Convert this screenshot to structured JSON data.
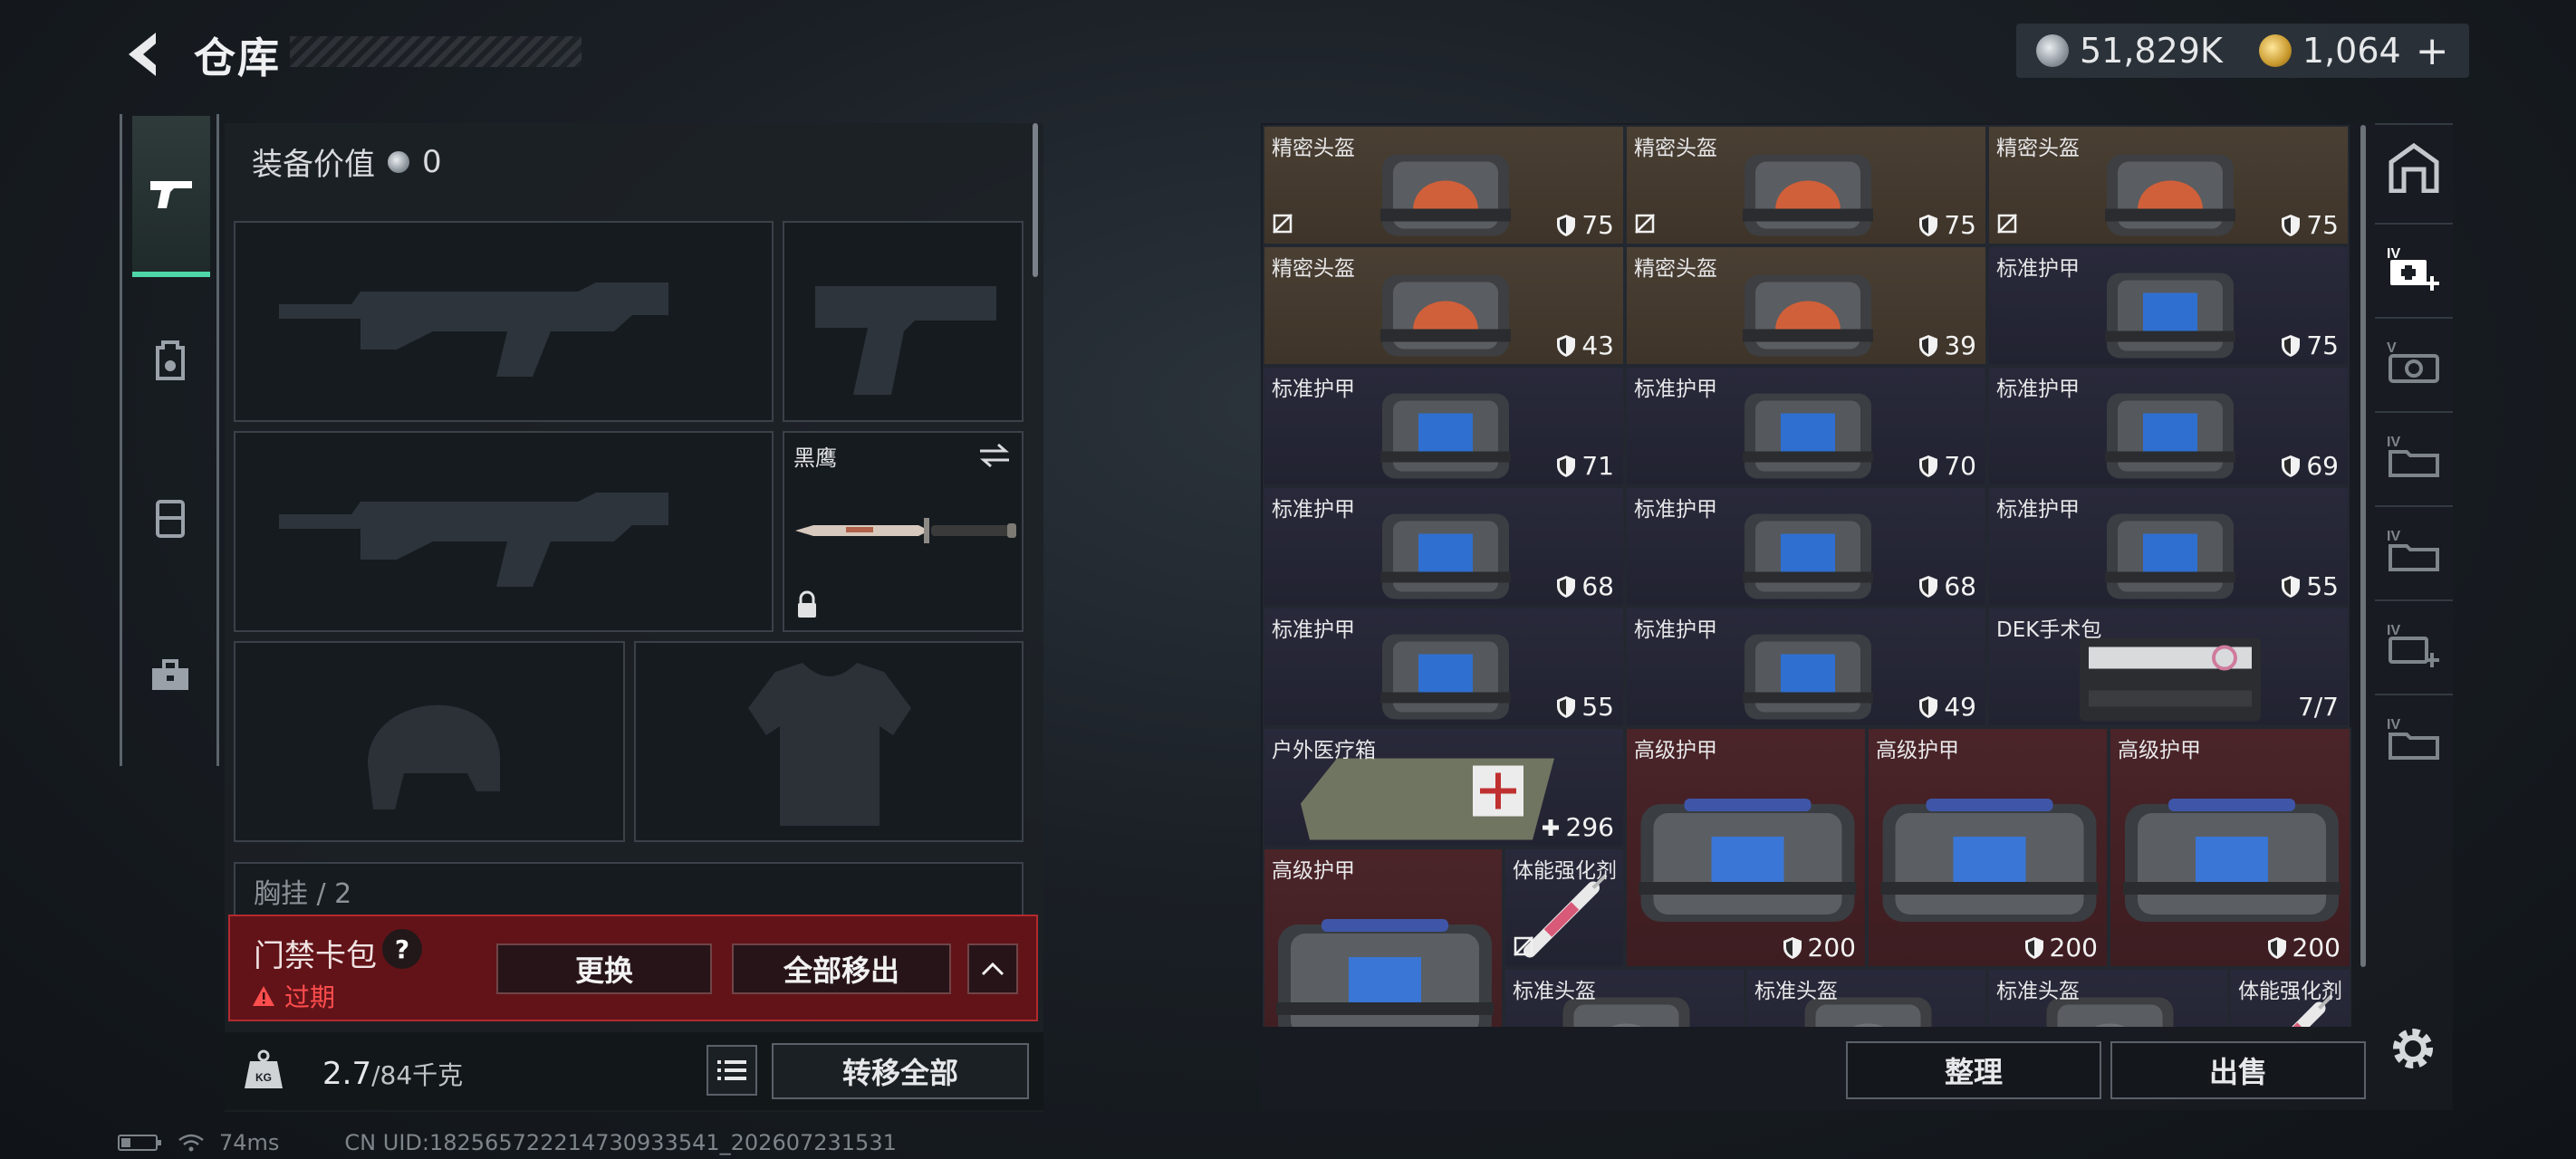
{
  "header": {
    "title": "仓库",
    "silver": "51,829K",
    "gold": "1,064",
    "plus": "+"
  },
  "equipment": {
    "value_label": "装备价值",
    "value": "0",
    "melee_name": "黑鹰",
    "chest_label": "胸挂 / 2"
  },
  "access_card": {
    "title": "门禁卡包",
    "help": "?",
    "expired": "过期",
    "replace": "更换",
    "remove_all": "全部移出"
  },
  "weight": {
    "current": "2.7",
    "capacity": "/84千克"
  },
  "transfer_all": "转移全部",
  "status": {
    "ping": "74ms",
    "uid": "CN UID:182565722214730933541_202607231531"
  },
  "storage": {
    "items": [
      {
        "name": "精密头盔",
        "value": "75",
        "kind": "helmet",
        "color": "brown",
        "noicon": true
      },
      {
        "name": "精密头盔",
        "value": "75",
        "kind": "helmet",
        "color": "brown",
        "noicon": true
      },
      {
        "name": "精密头盔",
        "value": "75",
        "kind": "helmet",
        "color": "brown",
        "noicon": true
      },
      {
        "name": "精密头盔",
        "value": "43",
        "kind": "helmet",
        "color": "brown"
      },
      {
        "name": "精密头盔",
        "value": "39",
        "kind": "helmet",
        "color": "brown"
      },
      {
        "name": "标准护甲",
        "value": "75",
        "kind": "armor",
        "color": "navy"
      },
      {
        "name": "标准护甲",
        "value": "71",
        "kind": "armor",
        "color": "navy"
      },
      {
        "name": "标准护甲",
        "value": "70",
        "kind": "armor",
        "color": "navy"
      },
      {
        "name": "标准护甲",
        "value": "69",
        "kind": "armor",
        "color": "navy"
      },
      {
        "name": "标准护甲",
        "value": "68",
        "kind": "armor",
        "color": "navy"
      },
      {
        "name": "标准护甲",
        "value": "68",
        "kind": "armor",
        "color": "navy"
      },
      {
        "name": "标准护甲",
        "value": "55",
        "kind": "armor",
        "color": "navy"
      },
      {
        "name": "标准护甲",
        "value": "55",
        "kind": "armor",
        "color": "navy"
      },
      {
        "name": "标准护甲",
        "value": "49",
        "kind": "armor",
        "color": "navy"
      },
      {
        "name": "DEK手术包",
        "value": "7/7",
        "kind": "kit",
        "color": "navy"
      },
      {
        "name": "户外医疗箱",
        "value": "296",
        "kind": "medbox",
        "color": "navy"
      },
      {
        "name": "高级护甲",
        "value": "200",
        "kind": "bigarmor",
        "color": "red"
      },
      {
        "name": "高级护甲",
        "value": "200",
        "kind": "bigarmor",
        "color": "red"
      },
      {
        "name": "高级护甲",
        "value": "200",
        "kind": "bigarmor",
        "color": "red"
      },
      {
        "name": "高级护甲",
        "value": "",
        "kind": "bigarmor",
        "color": "red"
      },
      {
        "name": "体能强化剂",
        "value": "",
        "kind": "syringe",
        "color": "navy",
        "noicon": true
      },
      {
        "name": "标准头盔",
        "value": "",
        "kind": "helmet2",
        "color": "navy"
      },
      {
        "name": "标准头盔",
        "value": "",
        "kind": "helmet2",
        "color": "navy"
      },
      {
        "name": "标准头盔",
        "value": "",
        "kind": "helmet2",
        "color": "navy"
      },
      {
        "name": "体能强化剂",
        "value": "",
        "kind": "syringe",
        "color": "navy"
      }
    ],
    "sort_label": "整理",
    "sell_label": "出售"
  },
  "side_tabs": [
    "IV",
    "V",
    "IV",
    "IV",
    "IV",
    "IV"
  ]
}
